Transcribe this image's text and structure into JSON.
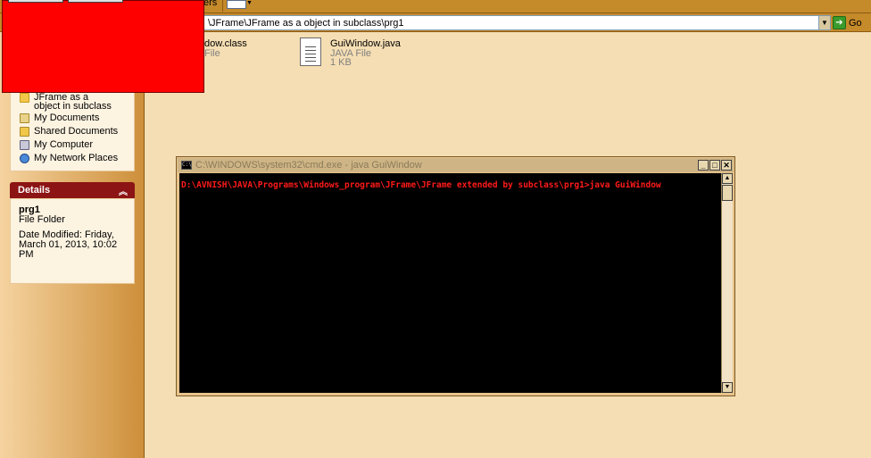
{
  "toolbar": {
    "folders_label_fragment": "ers",
    "views_icon": "views-icon"
  },
  "address": {
    "value": "\\JFrame\\JFrame as a object in subclass\\prg1",
    "go_label": "Go"
  },
  "files": [
    {
      "name": "dow.class",
      "type": "File"
    },
    {
      "name": "GuiWindow.java",
      "type": "JAVA File",
      "size": "1 KB"
    }
  ],
  "other_places": {
    "items": [
      {
        "label": "JFrame as a object in subclass",
        "icon": "folder-icon"
      },
      {
        "label": "My Documents",
        "icon": "my-documents-icon"
      },
      {
        "label": "Shared Documents",
        "icon": "shared-documents-icon"
      },
      {
        "label": "My Computer",
        "icon": "my-computer-icon"
      },
      {
        "label": "My Network Places",
        "icon": "network-places-icon"
      }
    ]
  },
  "details": {
    "header": "Details",
    "name": "prg1",
    "kind": "File Folder",
    "modified": "Date Modified: Friday, March 01, 2013, 10:02 PM"
  },
  "cmd": {
    "title": "C:\\WINDOWS\\system32\\cmd.exe - java GuiWindow",
    "line": "D:\\AVNISH\\JAVA\\Programs\\Windows_program\\JFrame\\JFrame extended by subclass\\prg1>java GuiWindow"
  },
  "colors": {
    "red_window": "#ff0000",
    "console_text": "#ff1a1a",
    "details_header": "#8c1414",
    "background": "#f5deb3"
  }
}
